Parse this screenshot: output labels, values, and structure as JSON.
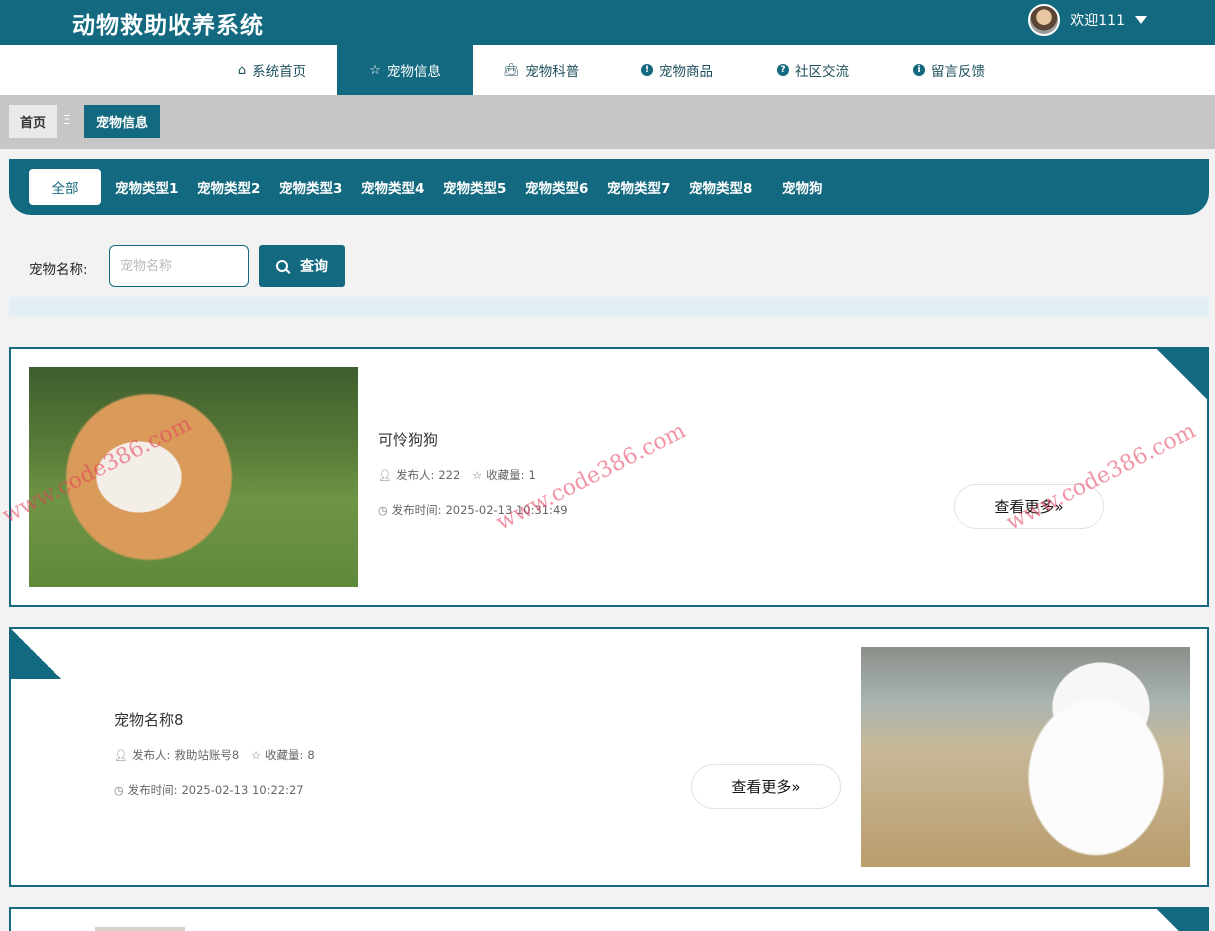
{
  "header": {
    "app_title": "动物救助收养系统",
    "user_greeting": "欢迎111"
  },
  "nav": {
    "items": [
      {
        "label": "系统首页",
        "icon": "home-icon"
      },
      {
        "label": "宠物信息",
        "icon": "star-icon"
      },
      {
        "label": "宠物科普",
        "icon": "bag-icon"
      },
      {
        "label": "宠物商品",
        "icon": "exclamation-icon"
      },
      {
        "label": "社区交流",
        "icon": "question-icon"
      },
      {
        "label": "留言反馈",
        "icon": "info-icon"
      }
    ],
    "active_index": 1
  },
  "breadcrumb": {
    "home": "首页",
    "separator": "Ξ",
    "current": "宠物信息"
  },
  "categories": {
    "all": "全部",
    "items": [
      "宠物类型1",
      "宠物类型2",
      "宠物类型3",
      "宠物类型4",
      "宠物类型5",
      "宠物类型6",
      "宠物类型7",
      "宠物类型8",
      "宠物狗"
    ]
  },
  "search": {
    "label": "宠物名称:",
    "placeholder": "宠物名称",
    "value": "",
    "button": "查询"
  },
  "pets": [
    {
      "name": "可怜狗狗",
      "publisher_label": "发布人:",
      "publisher": "222",
      "favorites_label": "收藏量:",
      "favorites": "1",
      "time_label": "发布时间:",
      "time": "2025-02-13 10:31:49",
      "more": "查看更多"
    },
    {
      "name": "宠物名称8",
      "publisher_label": "发布人:",
      "publisher": "救助站账号8",
      "favorites_label": "收藏量:",
      "favorites": "8",
      "time_label": "发布时间:",
      "time": "2025-02-13 10:22:27",
      "more": "查看更多"
    }
  ],
  "watermark": "www.code386.com",
  "colors": {
    "primary": "#13697f",
    "breadcrumb_bg": "#c6c6c6",
    "page_bg": "#f2f2f2"
  }
}
